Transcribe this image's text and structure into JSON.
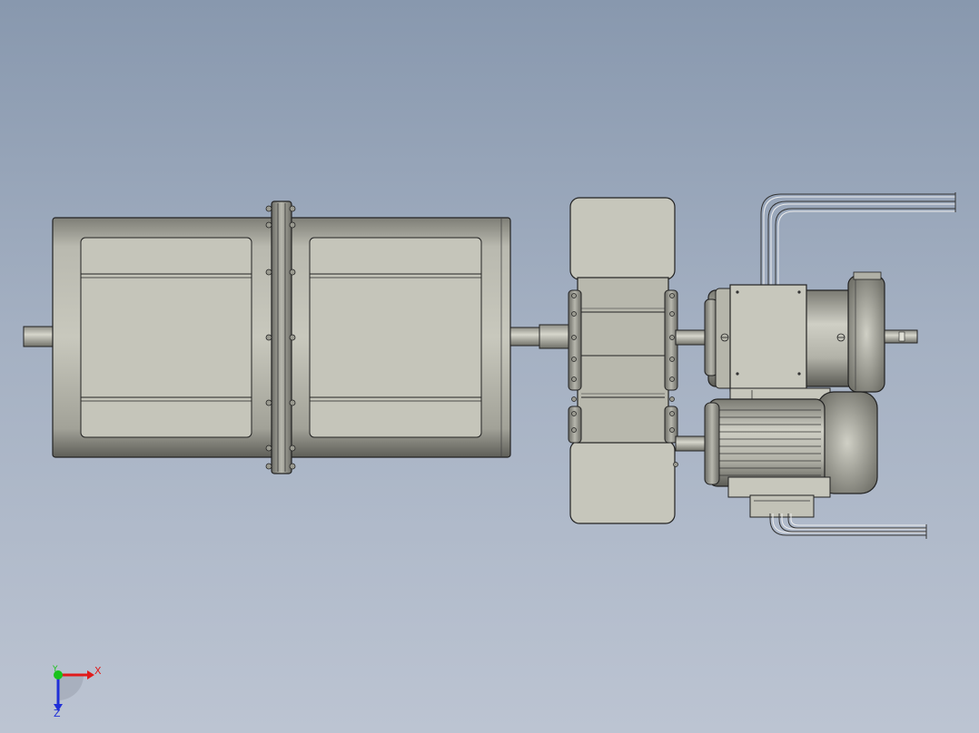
{
  "viewport": {
    "background_top": "#8898ae",
    "background_bottom": "#bcc4d2"
  },
  "colors": {
    "part_fill": "#c9c9bf",
    "part_fill_dark": "#a6a69c",
    "part_shadow": "#6d6d66",
    "edge": "#222222",
    "axis_x": "#e01b1b",
    "axis_y": "#19c21b",
    "axis_z": "#2030d8"
  },
  "triad": {
    "x_label": "X",
    "y_label": "Y",
    "z_label": "Z"
  },
  "model": {
    "components": [
      "left-drum-assembly",
      "center-flange-coupling",
      "shaft-left",
      "shaft-middle",
      "gearbox-housing",
      "brake-motor-upper",
      "motor-lower",
      "cable-bundle-upper",
      "cable-bundle-lower"
    ]
  }
}
